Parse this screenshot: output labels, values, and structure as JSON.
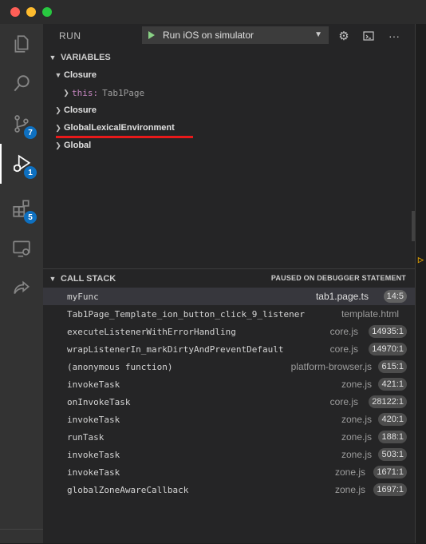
{
  "window": {
    "traffic_lights": [
      "#ff5f57",
      "#febc2e",
      "#28c840"
    ]
  },
  "activity_bar": {
    "items": [
      {
        "icon": "files-icon"
      },
      {
        "icon": "search-icon"
      },
      {
        "icon": "source-control-icon",
        "badge": "7"
      },
      {
        "icon": "run-debug-icon",
        "badge": "1",
        "active": true
      },
      {
        "icon": "extensions-icon",
        "badge": "5"
      },
      {
        "icon": "remote-explorer-icon"
      },
      {
        "icon": "live-share-icon"
      }
    ]
  },
  "run_view": {
    "title": "RUN",
    "config": {
      "selected": "Run iOS on simulator"
    },
    "actions": [
      "gear-icon",
      "debug-console-icon",
      "more-icon"
    ]
  },
  "variables": {
    "title": "VARIABLES",
    "closure_expanded": {
      "label": "Closure",
      "child_key": "this:",
      "child_value": "Tab1Page"
    },
    "rows": [
      {
        "label": "Closure"
      },
      {
        "label": "GlobalLexicalEnvironment"
      },
      {
        "label": "Global"
      }
    ]
  },
  "call_stack": {
    "title": "CALL STACK",
    "status": "PAUSED ON DEBUGGER STATEMENT",
    "frames": [
      {
        "name": "myFunc",
        "source": "tab1.page.ts",
        "position": "14:5"
      },
      {
        "name": "Tab1Page_Template_ion_button_click_9_listener",
        "source": "template.html",
        "position": ""
      },
      {
        "name": "executeListenerWithErrorHandling",
        "source": "core.js",
        "position": "14935:1"
      },
      {
        "name": "wrapListenerIn_markDirtyAndPreventDefault",
        "source": "core.js",
        "position": "14970:1"
      },
      {
        "name": "(anonymous function)",
        "source": "platform-browser.js",
        "position": "615:1"
      },
      {
        "name": "invokeTask",
        "source": "zone.js",
        "position": "421:1"
      },
      {
        "name": "onInvokeTask",
        "source": "core.js",
        "position": "28122:1"
      },
      {
        "name": "invokeTask",
        "source": "zone.js",
        "position": "420:1"
      },
      {
        "name": "runTask",
        "source": "zone.js",
        "position": "188:1"
      },
      {
        "name": "invokeTask",
        "source": "zone.js",
        "position": "503:1"
      },
      {
        "name": "invokeTask",
        "source": "zone.js",
        "position": "1671:1"
      },
      {
        "name": "globalZoneAwareCallback",
        "source": "zone.js",
        "position": "1697:1"
      }
    ]
  }
}
